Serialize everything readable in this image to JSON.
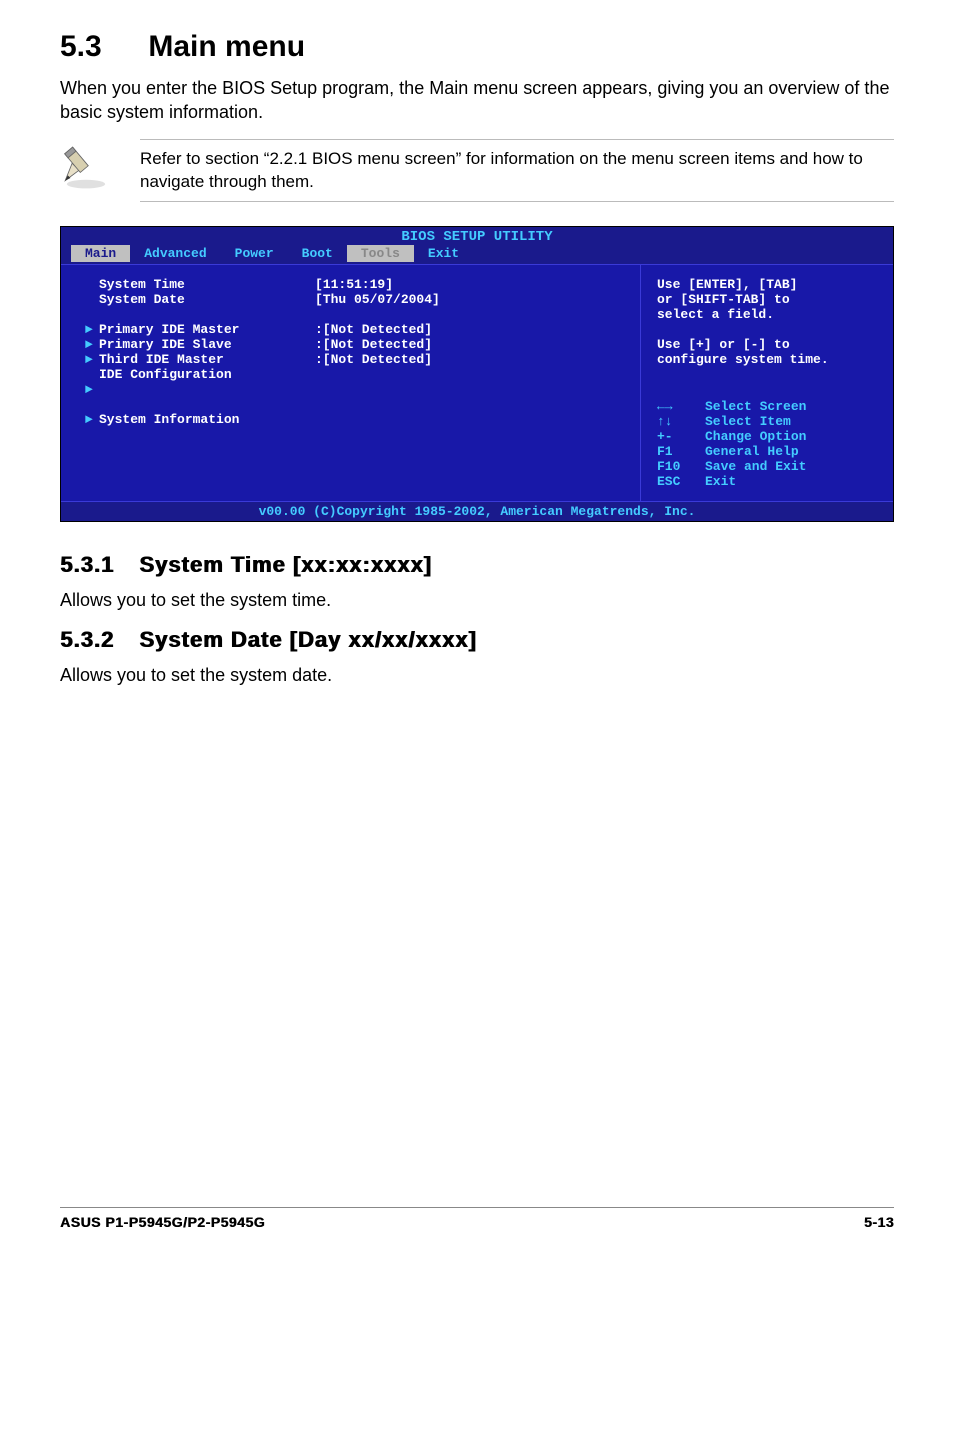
{
  "section": {
    "number": "5.3",
    "title": "Main menu",
    "intro": "When you enter the BIOS Setup program, the Main menu screen appears, giving you an overview of the basic system information."
  },
  "note": "Refer to section “2.2.1  BIOS menu screen” for information on the menu screen items and how to navigate through them.",
  "bios": {
    "title": "BIOS SETUP UTILITY",
    "tabs": [
      "Main",
      "Advanced",
      "Power",
      "Boot",
      "Tools",
      "Exit"
    ],
    "active_tab": 0,
    "items": [
      {
        "label": "System Time",
        "value": "[11:51:19]",
        "arrow": false
      },
      {
        "label": "System Date",
        "value": "[Thu 05/07/2004]",
        "arrow": false
      },
      {
        "label": "",
        "value": "",
        "arrow": false
      },
      {
        "label": "Primary IDE Master",
        "value": ":[Not Detected]",
        "arrow": true
      },
      {
        "label": "Primary IDE Slave",
        "value": ":[Not Detected]",
        "arrow": true
      },
      {
        "label": "Third IDE Master",
        "value": ":[Not Detected]",
        "arrow": true
      },
      {
        "label": "IDE Configuration",
        "value": "",
        "arrow_below": true
      },
      {
        "label": "",
        "value": "",
        "arrow": false
      },
      {
        "label": "System Information",
        "value": "",
        "arrow": true
      }
    ],
    "right_help": [
      "Use [ENTER], [TAB]",
      "or [SHIFT-TAB] to",
      "select a field.",
      "",
      "Use [+] or [-] to",
      "configure system time."
    ],
    "nav_help": [
      {
        "key": "←→",
        "desc": "Select Screen"
      },
      {
        "key": "↑↓",
        "desc": "Select Item"
      },
      {
        "key": "+-",
        "desc": "Change Option"
      },
      {
        "key": "F1",
        "desc": "General Help"
      },
      {
        "key": "F10",
        "desc": "Save and Exit"
      },
      {
        "key": "ESC",
        "desc": "Exit"
      }
    ],
    "footer": "v00.00 (C)Copyright 1985-2002, American Megatrends, Inc."
  },
  "sub1": {
    "number": "5.3.1",
    "title": "System Time [xx:xx:xxxx]",
    "body": "Allows you to set the system time."
  },
  "sub2": {
    "number": "5.3.2",
    "title": "System Date [Day xx/xx/xxxx]",
    "body": "Allows you to set the system date."
  },
  "footer": {
    "left": "ASUS P1-P5945G/P2-P5945G",
    "right": "5-13"
  }
}
